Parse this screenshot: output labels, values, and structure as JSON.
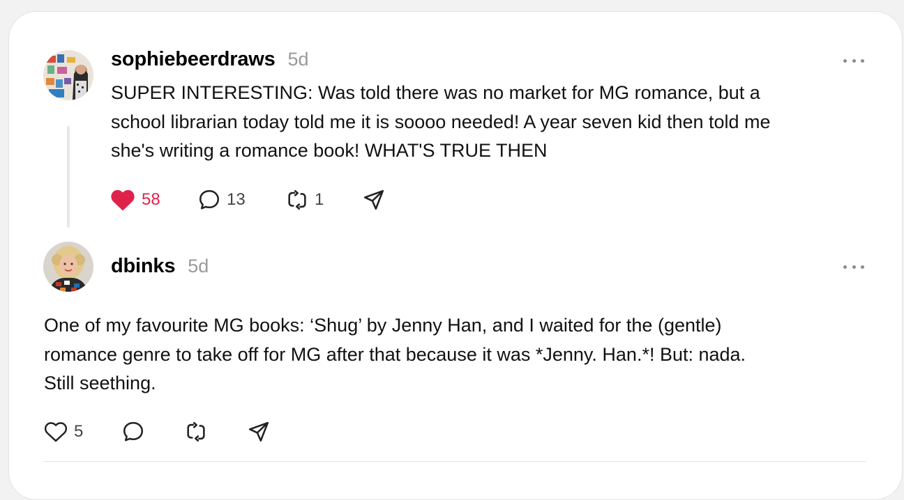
{
  "comments": [
    {
      "author": "sophiebeerdraws",
      "time": "5d",
      "text": "SUPER INTERESTING: Was told there was no market for MG romance, but a school librarian today told me it is soooo needed! A year seven kid then told me she's writing a romance book! WHAT'S TRUE THEN",
      "text_lines": [
        "SUPER INTERESTING: Was told there was no market for MG romance, but a",
        "school librarian today told me it is soooo needed! A year seven kid then told me",
        "she's writing a romance book! WHAT'S TRUE THEN"
      ],
      "likes": "58",
      "liked": true,
      "replies": "13",
      "restacks": "1"
    },
    {
      "author": "dbinks",
      "time": "5d",
      "text_lines": [
        "One of my favourite MG books: ‘Shug’ by Jenny Han, and I waited for the (gentle)",
        "romance genre to take off for MG after that because it was *Jenny. Han.*! But: nada.",
        "Still seething."
      ],
      "likes": "5",
      "liked": false
    }
  ],
  "icons": {
    "like": "heart-icon",
    "reply": "speech-bubble-icon",
    "restack": "restack-arrows-icon",
    "share": "paper-plane-icon",
    "more": "ellipsis-icon"
  },
  "colors": {
    "liked_heart": "#e0224a",
    "muted_text": "#9a9a9a"
  }
}
